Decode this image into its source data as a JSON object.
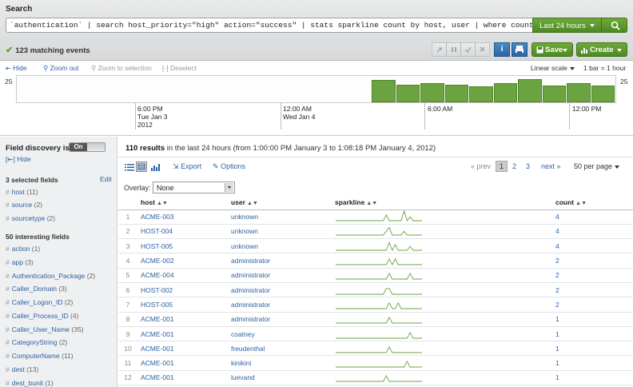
{
  "search": {
    "title": "Search",
    "query": "`authentication` | search host_priority=\"high\" action=\"success\" | stats sparkline count by host, user | where count > 0 | sort -count",
    "time_range": "Last 24 hours",
    "matching_events": "123 matching events"
  },
  "toolbar": {
    "save_label": "Save",
    "create_label": "Create",
    "info_label": "i"
  },
  "timeline": {
    "hide": "Hide",
    "zoom_out": "Zoom out",
    "zoom_sel": "Zoom to selection",
    "deselect": "Deselect",
    "scale": "Linear scale",
    "bar_label": "1 bar = 1 hour",
    "y_max": "25",
    "tick_1": [
      "6:00 PM",
      "Tue Jan 3",
      "2012"
    ],
    "tick_2": [
      "12:00 AM",
      "Wed Jan 4"
    ],
    "tick_3": [
      "6:00 AM"
    ],
    "tick_4": [
      "12:00 PM"
    ],
    "bar_values": [
      21,
      17,
      18,
      17,
      15,
      18,
      22,
      16,
      18,
      16
    ],
    "bar_max": 25
  },
  "sidebar": {
    "fd_label": "Field discovery is:",
    "fd_toggle": "On",
    "hide": "Hide",
    "selected_head": "3 selected fields",
    "edit": "Edit",
    "selected": [
      {
        "name": "host",
        "count": "(11)"
      },
      {
        "name": "source",
        "count": "(2)"
      },
      {
        "name": "sourcetype",
        "count": "(2)"
      }
    ],
    "interesting_head": "50 interesting fields",
    "interesting": [
      {
        "name": "action",
        "count": "(1)"
      },
      {
        "name": "app",
        "count": "(3)"
      },
      {
        "name": "Authentication_Package",
        "count": "(2)"
      },
      {
        "name": "Caller_Domain",
        "count": "(3)"
      },
      {
        "name": "Caller_Logon_ID",
        "count": "(2)"
      },
      {
        "name": "Caller_Process_ID",
        "count": "(4)"
      },
      {
        "name": "Caller_User_Name",
        "count": "(35)"
      },
      {
        "name": "CategoryString",
        "count": "(2)"
      },
      {
        "name": "ComputerName",
        "count": "(11)"
      },
      {
        "name": "dest",
        "count": "(13)"
      },
      {
        "name": "dest_bunit",
        "count": "(1)"
      }
    ]
  },
  "results": {
    "count": "110 results",
    "summary_rest": " in the last 24 hours (from 1:00:00 PM January 3 to 1:08:18 PM January 4, 2012)",
    "export": "Export",
    "options": "Options",
    "prev": "« prev",
    "pages": [
      "1",
      "2",
      "3"
    ],
    "next": "next »",
    "per_page": "50 per page",
    "overlay_label": "Overlay:",
    "overlay_value": "None",
    "columns": [
      "host",
      "user",
      "sparkline",
      "count"
    ],
    "rows": [
      {
        "n": "1",
        "host": "ACME-003",
        "user": "unknown",
        "count": "4",
        "spark": [
          0,
          0,
          0,
          0,
          0,
          0,
          0,
          0,
          0,
          0,
          0,
          0,
          0,
          0,
          0,
          0,
          0,
          3,
          0,
          0,
          0,
          0,
          0,
          5,
          0,
          2,
          0,
          0,
          0,
          0
        ]
      },
      {
        "n": "2",
        "host": "HOST-004",
        "user": "unknown",
        "count": "4",
        "spark": [
          0,
          0,
          0,
          0,
          0,
          0,
          0,
          0,
          0,
          0,
          0,
          0,
          0,
          0,
          0,
          0,
          0,
          2,
          4,
          0,
          0,
          0,
          0,
          2,
          0,
          0,
          0,
          0,
          0,
          0
        ]
      },
      {
        "n": "3",
        "host": "HOST-005",
        "user": "unknown",
        "count": "4",
        "spark": [
          0,
          0,
          0,
          0,
          0,
          0,
          0,
          0,
          0,
          0,
          0,
          0,
          0,
          0,
          0,
          0,
          0,
          0,
          4,
          0,
          3,
          0,
          0,
          0,
          0,
          2,
          0,
          0,
          0,
          0
        ]
      },
      {
        "n": "4",
        "host": "ACME-002",
        "user": "administrator",
        "count": "2",
        "spark": [
          0,
          0,
          0,
          0,
          0,
          0,
          0,
          0,
          0,
          0,
          0,
          0,
          0,
          0,
          0,
          0,
          0,
          0,
          3,
          0,
          3,
          0,
          0,
          0,
          0,
          0,
          0,
          0,
          0,
          0
        ]
      },
      {
        "n": "5",
        "host": "ACME-004",
        "user": "administrator",
        "count": "2",
        "spark": [
          0,
          0,
          0,
          0,
          0,
          0,
          0,
          0,
          0,
          0,
          0,
          0,
          0,
          0,
          0,
          0,
          0,
          0,
          3,
          0,
          0,
          0,
          0,
          0,
          0,
          3,
          0,
          0,
          0,
          0
        ]
      },
      {
        "n": "6",
        "host": "HOST-002",
        "user": "administrator",
        "count": "2",
        "spark": [
          0,
          0,
          0,
          0,
          0,
          0,
          0,
          0,
          0,
          0,
          0,
          0,
          0,
          0,
          0,
          0,
          0,
          3,
          3,
          0,
          0,
          0,
          0,
          0,
          0,
          0,
          0,
          0,
          0,
          0
        ]
      },
      {
        "n": "7",
        "host": "HOST-005",
        "user": "administrator",
        "count": "2",
        "spark": [
          0,
          0,
          0,
          0,
          0,
          0,
          0,
          0,
          0,
          0,
          0,
          0,
          0,
          0,
          0,
          0,
          0,
          0,
          3,
          0,
          0,
          3,
          0,
          0,
          0,
          0,
          0,
          0,
          0,
          0
        ]
      },
      {
        "n": "8",
        "host": "ACME-001",
        "user": "administrator",
        "count": "1",
        "spark": [
          0,
          0,
          0,
          0,
          0,
          0,
          0,
          0,
          0,
          0,
          0,
          0,
          0,
          0,
          0,
          0,
          0,
          0,
          3,
          0,
          0,
          0,
          0,
          0,
          0,
          0,
          0,
          0,
          0,
          0
        ]
      },
      {
        "n": "9",
        "host": "ACME-001",
        "user": "coatney",
        "count": "1",
        "spark": [
          0,
          0,
          0,
          0,
          0,
          0,
          0,
          0,
          0,
          0,
          0,
          0,
          0,
          0,
          0,
          0,
          0,
          0,
          0,
          0,
          0,
          0,
          0,
          0,
          0,
          3,
          0,
          0,
          0,
          0
        ]
      },
      {
        "n": "10",
        "host": "ACME-001",
        "user": "freudenthal",
        "count": "1",
        "spark": [
          0,
          0,
          0,
          0,
          0,
          0,
          0,
          0,
          0,
          0,
          0,
          0,
          0,
          0,
          0,
          0,
          0,
          0,
          3,
          0,
          0,
          0,
          0,
          0,
          0,
          0,
          0,
          0,
          0,
          0
        ]
      },
      {
        "n": "11",
        "host": "ACME-001",
        "user": "kinikini",
        "count": "1",
        "spark": [
          0,
          0,
          0,
          0,
          0,
          0,
          0,
          0,
          0,
          0,
          0,
          0,
          0,
          0,
          0,
          0,
          0,
          0,
          0,
          0,
          0,
          0,
          0,
          0,
          3,
          0,
          0,
          0,
          0,
          0
        ]
      },
      {
        "n": "12",
        "host": "ACME-001",
        "user": "luevand",
        "count": "1",
        "spark": [
          0,
          0,
          0,
          0,
          0,
          0,
          0,
          0,
          0,
          0,
          0,
          0,
          0,
          0,
          0,
          0,
          0,
          3,
          0,
          0,
          0,
          0,
          0,
          0,
          0,
          0,
          0,
          0,
          0,
          0
        ]
      }
    ]
  },
  "colors": {
    "accent_green": "#6aa33f",
    "link_blue": "#2d62a3"
  }
}
